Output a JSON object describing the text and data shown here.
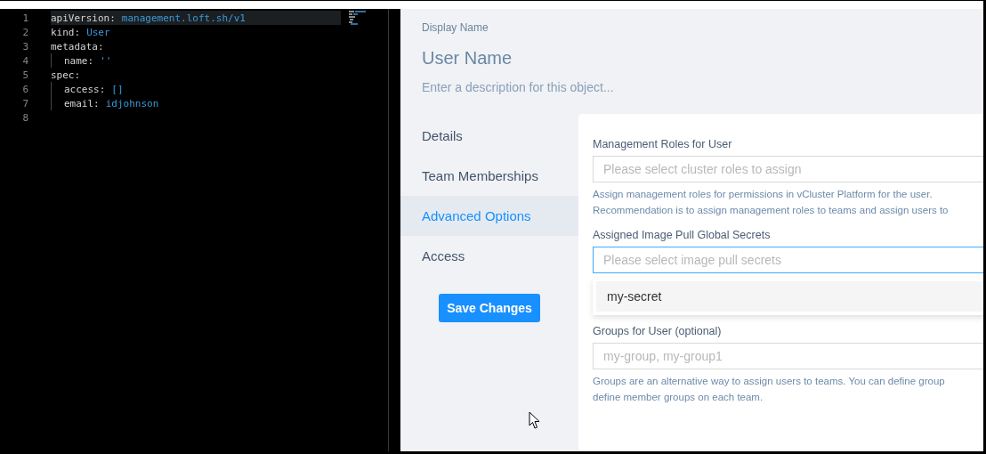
{
  "editor": {
    "lines": [
      {
        "number": "1",
        "indented": false,
        "current": true,
        "key": "apiVersion:",
        "value": "management.loft.sh/v1"
      },
      {
        "number": "2",
        "indented": false,
        "current": false,
        "key": "kind:",
        "value": "User"
      },
      {
        "number": "3",
        "indented": false,
        "current": false,
        "key": "metadata:"
      },
      {
        "number": "4",
        "indented": true,
        "current": false,
        "key": "name:",
        "value": "''"
      },
      {
        "number": "5",
        "indented": false,
        "current": false,
        "key": "spec:"
      },
      {
        "number": "6",
        "indented": true,
        "current": false,
        "key": "access:",
        "value": "[]"
      },
      {
        "number": "7",
        "indented": true,
        "current": false,
        "key": "email:",
        "value": "idjohnson"
      },
      {
        "number": "8",
        "indented": false,
        "current": false
      }
    ]
  },
  "header": {
    "label": "Display Name",
    "name_placeholder": "User Name",
    "description_placeholder": "Enter a description for this object..."
  },
  "tabs": [
    {
      "label": "Details",
      "selected": false
    },
    {
      "label": "Team Memberships",
      "selected": false
    },
    {
      "label": "Advanced Options",
      "selected": true
    },
    {
      "label": "Access",
      "selected": false
    }
  ],
  "save_button": "Save Changes",
  "fields": [
    {
      "label": "Management Roles for User",
      "placeholder": "Please select cluster roles to assign",
      "focused": false,
      "help": [
        "Assign management roles for permissions in vCluster Platform for the user.",
        "Recommendation is to assign management roles to teams and assign users to"
      ]
    },
    {
      "label": "Assigned Image Pull Global Secrets",
      "placeholder": "Please select image pull secrets",
      "focused": true,
      "options": [
        "my-secret"
      ]
    },
    {
      "label": "Groups for User (optional)",
      "placeholder": "my-group, my-group1",
      "focused": false,
      "help": [
        "Groups are an alternative way to assign users to teams. You can define group",
        "define member groups on each team."
      ]
    }
  ]
}
